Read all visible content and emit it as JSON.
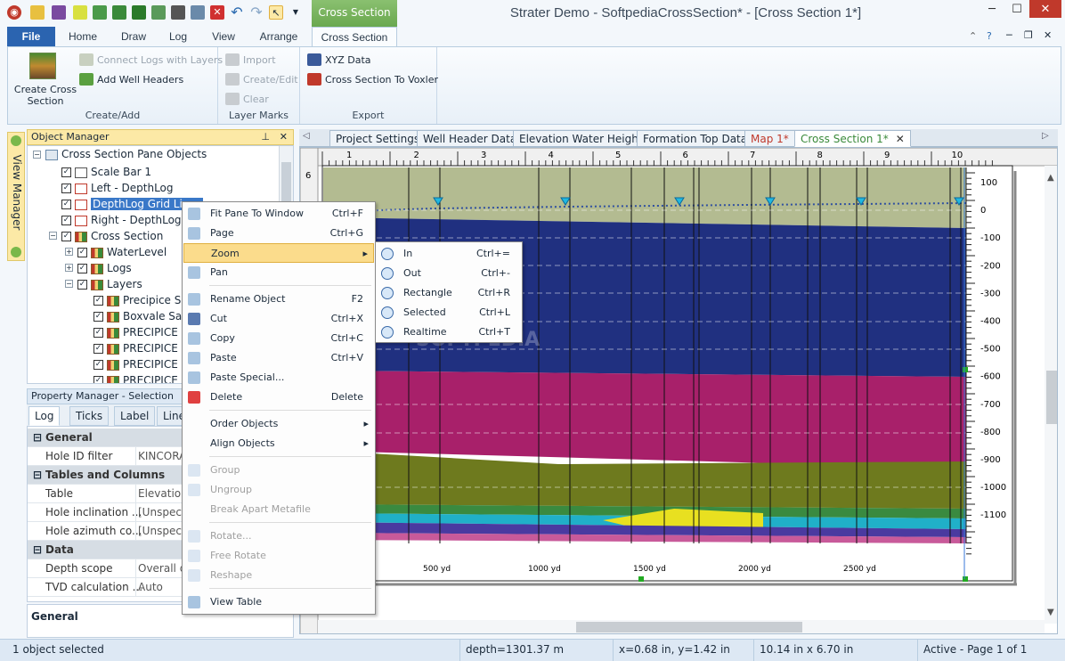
{
  "window": {
    "title": "Strater Demo - SoftpediaCrossSection* - [Cross Section 1*]",
    "contextual_tab": "Cross Section"
  },
  "ribbon_tabs": [
    "File",
    "Home",
    "Draw",
    "Log",
    "View",
    "Arrange",
    "Cross Section"
  ],
  "ribbon": {
    "create_cross_section": "Create Cross Section",
    "connect_logs": "Connect Logs with Layers",
    "add_well_headers": "Add Well Headers",
    "group_create": "Create/Add",
    "import": "Import",
    "create_edit": "Create/Edit",
    "clear": "Clear",
    "group_layer_marks": "Layer Marks",
    "xyz_data": "XYZ Data",
    "to_voxler": "Cross Section To Voxler",
    "group_export": "Export"
  },
  "side_tab": "View Manager",
  "object_manager": {
    "title": "Object Manager",
    "pin": "—",
    "close": "✕",
    "tree": [
      {
        "label": "Cross Section Pane Objects",
        "level": 0
      },
      {
        "label": "Scale Bar 1",
        "level": 1
      },
      {
        "label": "Left - DepthLog",
        "level": 1
      },
      {
        "label": "DepthLog Grid Lines",
        "level": 1
      },
      {
        "label": "Right - DepthLog",
        "level": 1
      },
      {
        "label": "Cross Section",
        "level": 1
      },
      {
        "label": "WaterLevel",
        "level": 2
      },
      {
        "label": "Logs",
        "level": 2
      },
      {
        "label": "Layers",
        "level": 2
      },
      {
        "label": "Precipice Sandstone",
        "level": 3
      },
      {
        "label": "Boxvale Sandstone",
        "level": 3
      },
      {
        "label": "PRECIPICE SANDSTONE",
        "level": 3
      },
      {
        "label": "PRECIPICE SANDSTONE",
        "level": 3
      },
      {
        "label": "PRECIPICE SANDSTONE",
        "level": 3
      },
      {
        "label": "PRECIPICE SANDSTONE",
        "level": 3
      }
    ]
  },
  "property_manager": {
    "title": "Property Manager - Selection",
    "tabs": [
      "Log",
      "Ticks",
      "Label",
      "Line"
    ],
    "rows": [
      {
        "section": "General"
      },
      {
        "key": "Hole ID filter",
        "value": "KINCORA"
      },
      {
        "section": "Tables and Columns"
      },
      {
        "key": "Table",
        "value": "Elevation"
      },
      {
        "key": "Hole inclination ...",
        "value": "[Unspecified]"
      },
      {
        "key": "Hole azimuth co...",
        "value": "[Unspecified]"
      },
      {
        "section": "Data"
      },
      {
        "key": "Depth scope",
        "value": "Overall depth"
      },
      {
        "key": "TVD calculation ...",
        "value": "Auto"
      }
    ],
    "description": "General"
  },
  "doc_tabs": [
    "Project Settings",
    "Well Header Data",
    "Elevation Water Height",
    "Formation Top Data",
    "Map 1*",
    "Cross Section 1*"
  ],
  "context_menu": [
    {
      "label": "Fit Pane To Window",
      "key": "Ctrl+F",
      "icon": "fit-icon"
    },
    {
      "label": "Page",
      "key": "Ctrl+G",
      "icon": "page-icon"
    },
    {
      "label": "Zoom",
      "key": "",
      "submenu": true,
      "highlight": true
    },
    {
      "label": "Pan",
      "key": "",
      "icon": "hand-icon"
    },
    {
      "sep": true
    },
    {
      "label": "Rename Object",
      "key": "F2",
      "icon": "rename-icon"
    },
    {
      "label": "Cut",
      "key": "Ctrl+X",
      "icon": "scissors-icon"
    },
    {
      "label": "Copy",
      "key": "Ctrl+C",
      "icon": "copy-icon"
    },
    {
      "label": "Paste",
      "key": "Ctrl+V",
      "icon": "paste-icon"
    },
    {
      "label": "Paste Special...",
      "key": "",
      "icon": "paste-special-icon"
    },
    {
      "label": "Delete",
      "key": "Delete",
      "icon": "delete-icon"
    },
    {
      "sep": true
    },
    {
      "label": "Order Objects",
      "key": "",
      "submenu": true
    },
    {
      "label": "Align Objects",
      "key": "",
      "submenu": true
    },
    {
      "sep": true
    },
    {
      "label": "Group",
      "key": "",
      "disabled": true,
      "icon": "group-icon"
    },
    {
      "label": "Ungroup",
      "key": "",
      "disabled": true,
      "icon": "ungroup-icon"
    },
    {
      "label": "Break Apart Metafile",
      "key": "",
      "disabled": true
    },
    {
      "sep": true
    },
    {
      "label": "Rotate...",
      "key": "",
      "disabled": true,
      "icon": "rotate-icon"
    },
    {
      "label": "Free Rotate",
      "key": "",
      "disabled": true,
      "icon": "free-rotate-icon"
    },
    {
      "label": "Reshape",
      "key": "",
      "disabled": true,
      "icon": "reshape-icon"
    },
    {
      "sep": true
    },
    {
      "label": "View Table",
      "key": "",
      "icon": "table-icon"
    }
  ],
  "zoom_submenu": [
    {
      "label": "In",
      "key": "Ctrl+="
    },
    {
      "label": "Out",
      "key": "Ctrl+-"
    },
    {
      "label": "Rectangle",
      "key": "Ctrl+R"
    },
    {
      "label": "Selected",
      "key": "Ctrl+L"
    },
    {
      "label": "Realtime",
      "key": "Ctrl+T"
    }
  ],
  "ruler_top": [
    "1",
    "2",
    "3",
    "4",
    "5",
    "6",
    "7",
    "8",
    "9",
    "10"
  ],
  "ruler_left": [
    "6"
  ],
  "depth_axis": [
    "100",
    "0",
    "-100",
    "-200",
    "-300",
    "-400",
    "-500",
    "-600",
    "-700",
    "-800",
    "-900",
    "-1000",
    "-1100"
  ],
  "scale_bar": [
    "500 yd",
    "1000 yd",
    "1500 yd",
    "2000 yd",
    "2500 yd"
  ],
  "watermark": "SOFTPEDIA",
  "status": {
    "selection": "1 object selected",
    "depth": "depth=1301.37 m",
    "cursor": "x=0.68 in, y=1.42 in",
    "size": "10.14 in x 6.70 in",
    "page": "Active - Page 1 of 1"
  },
  "colors": {
    "layer_top": "#b3bb91",
    "layer_navy": "#203080",
    "layer_magenta": "#a8206a",
    "layer_olive": "#6e7a1e",
    "layer_green": "#3a8a40",
    "layer_cyan": "#20b0c8",
    "layer_yellow": "#e8e020",
    "accent_tab": "#6aa84f"
  }
}
